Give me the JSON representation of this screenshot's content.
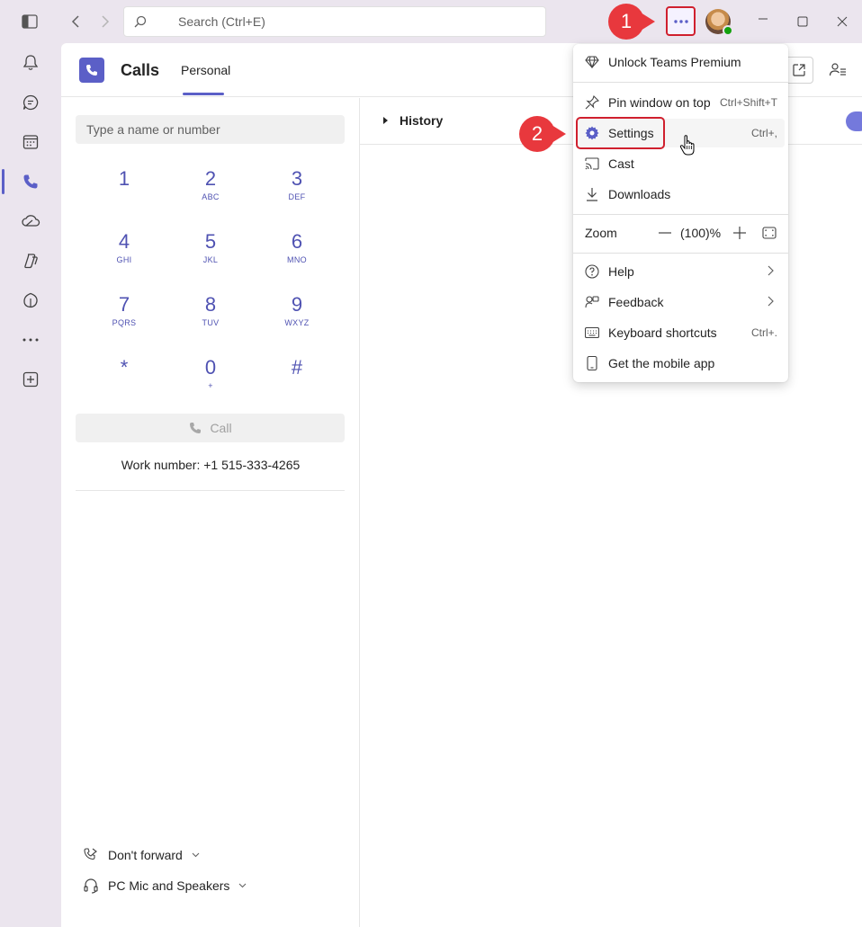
{
  "titlebar": {
    "search_placeholder": "Search (Ctrl+E)",
    "more_label": "...",
    "window_controls": [
      "minimize",
      "maximize",
      "close"
    ]
  },
  "callouts": {
    "step1": "1",
    "step2": "2"
  },
  "rail": {
    "items": [
      "activity",
      "chat",
      "calendar",
      "calls",
      "onedrive",
      "copilot",
      "viva",
      "more",
      "apps"
    ],
    "active": "calls"
  },
  "header": {
    "title": "Calls",
    "tab": "Personal"
  },
  "dialpad": {
    "placeholder": "Type a name or number",
    "keys": [
      {
        "digit": "1",
        "letters": ""
      },
      {
        "digit": "2",
        "letters": "ABC"
      },
      {
        "digit": "3",
        "letters": "DEF"
      },
      {
        "digit": "4",
        "letters": "GHI"
      },
      {
        "digit": "5",
        "letters": "JKL"
      },
      {
        "digit": "6",
        "letters": "MNO"
      },
      {
        "digit": "7",
        "letters": "PQRS"
      },
      {
        "digit": "8",
        "letters": "TUV"
      },
      {
        "digit": "9",
        "letters": "WXYZ"
      },
      {
        "digit": "*",
        "letters": ""
      },
      {
        "digit": "0",
        "letters": "+"
      },
      {
        "digit": "#",
        "letters": ""
      }
    ],
    "call_label": "Call",
    "work_number": "Work number: +1 515-333-4265"
  },
  "footer": {
    "forward": "Don't forward",
    "device": "PC Mic and Speakers"
  },
  "history": {
    "label": "History"
  },
  "menu": {
    "premium": "Unlock Teams Premium",
    "pin": "Pin window on top",
    "pin_shortcut": "Ctrl+Shift+T",
    "settings": "Settings",
    "settings_shortcut": "Ctrl+,",
    "cast": "Cast",
    "downloads": "Downloads",
    "zoom_label": "Zoom",
    "zoom_value": "(100)%",
    "help": "Help",
    "feedback": "Feedback",
    "keyboard": "Keyboard shortcuts",
    "keyboard_shortcut": "Ctrl+.",
    "mobile": "Get the mobile app"
  },
  "colors": {
    "accent": "#5b5fc7",
    "callout": "#e8383d",
    "highlight_border": "#d0202e"
  }
}
